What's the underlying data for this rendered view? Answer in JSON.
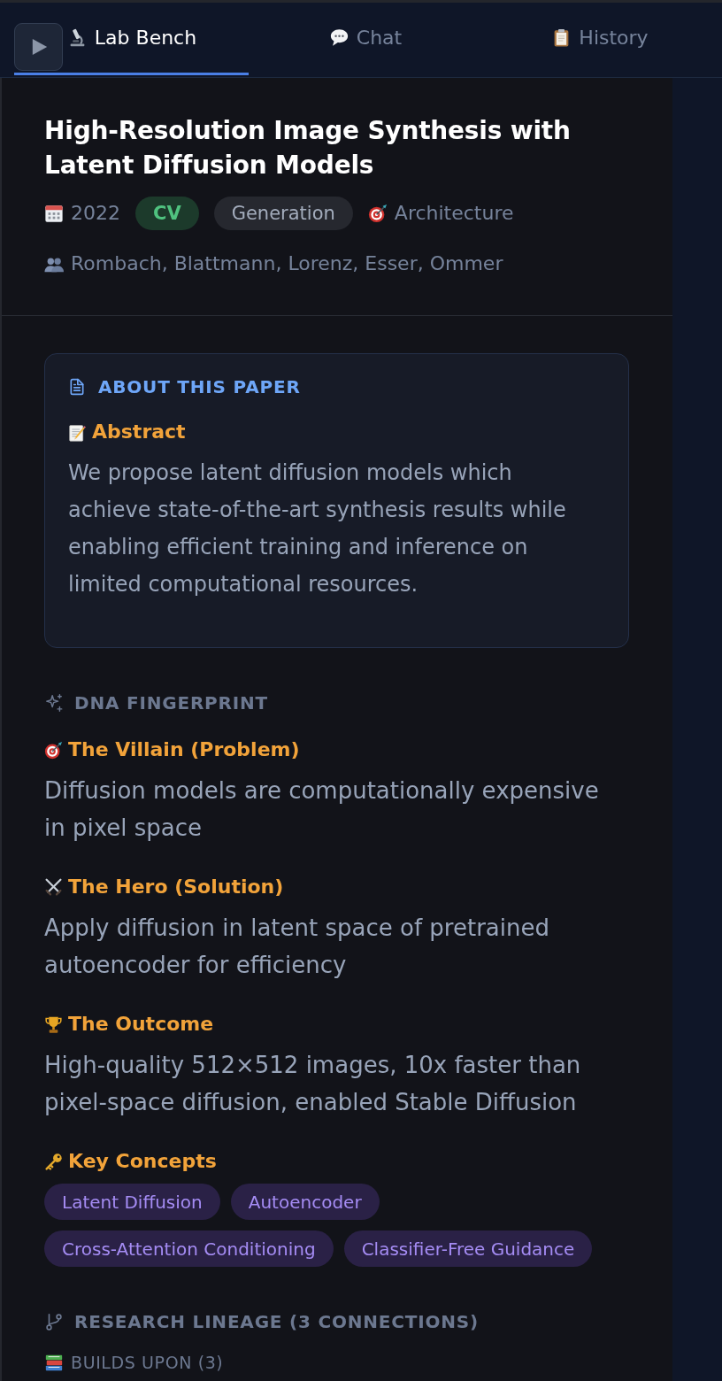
{
  "tabs": [
    {
      "label": "Lab Bench",
      "selected": true
    },
    {
      "label": "Chat",
      "selected": false
    },
    {
      "label": "History",
      "selected": false
    }
  ],
  "paper": {
    "title": "High-Resolution Image Synthesis with Latent Diffusion Models",
    "year": "2022",
    "tags": [
      {
        "label": "CV",
        "kind": "domain",
        "color": "#1c3a2b"
      },
      {
        "label": "Generation",
        "kind": "topic",
        "color": "#26282f"
      }
    ],
    "category": "Architecture",
    "authors": "Rombach, Blattmann, Lorenz, Esser, Ommer"
  },
  "about": {
    "heading": "ABOUT THIS PAPER",
    "abstract_label": "Abstract",
    "abstract": "We propose latent diffusion models which achieve state-of-the-art synthesis results while enabling efficient training and inference on limited computational resources."
  },
  "fingerprint": {
    "heading": "DNA FINGERPRINT",
    "items": [
      {
        "kind": "problem",
        "label": "The Villain (Problem)",
        "text": "Diffusion models are computationally expensive in pixel space"
      },
      {
        "kind": "solution",
        "label": "The Hero (Solution)",
        "text": "Apply diffusion in latent space of pretrained autoencoder for efficiency"
      },
      {
        "kind": "outcome",
        "label": "The Outcome",
        "text": "High-quality 512×512 images, 10x faster than pixel-space diffusion, enabled Stable Diffusion"
      }
    ],
    "concepts_label": "Key Concepts",
    "concepts": [
      "Latent Diffusion",
      "Autoencoder",
      "Cross-Attention Conditioning",
      "Classifier-Free Guidance"
    ]
  },
  "lineage": {
    "heading": "RESEARCH LINEAGE (3 CONNECTIONS)",
    "builds_upon": "BUILDS UPON (3)"
  }
}
